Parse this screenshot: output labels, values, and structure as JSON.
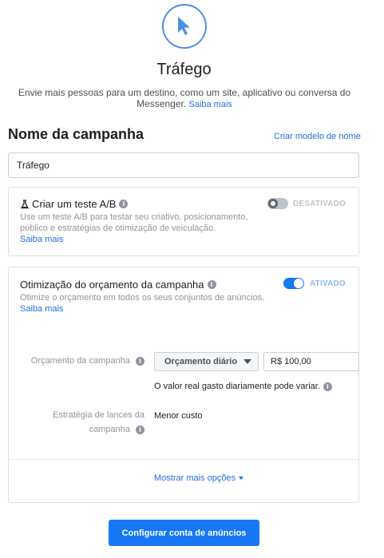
{
  "objective": {
    "icon": "cursor-icon",
    "title": "Tráfego",
    "description": "Envie mais pessoas para um destino, como um site, aplicativo ou conversa do Messenger.",
    "learn_more": "Saiba mais"
  },
  "campaign_name": {
    "title": "Nome da campanha",
    "template_link": "Criar modelo de nome",
    "value": "Tráfego"
  },
  "ab_test": {
    "title": "Criar um teste A/B",
    "description_line1": "Use um teste A/B para testar seu criativo, posicionamento,",
    "description_line2": "público e estratégias de otimização de veiculação.",
    "learn_more": "Saiba mais",
    "toggle_state": "DESATIVADO",
    "toggle_on": false
  },
  "budget_optimization": {
    "title": "Otimização do orçamento da campanha",
    "description": "Otimize o orçamento em todos os seus conjuntos de anúncios.",
    "learn_more": "Saiba mais",
    "toggle_state": "ATIVADO",
    "toggle_on": true,
    "budget_label": "Orçamento da campanha",
    "budget_type": "Orçamento diário",
    "budget_value": "R$ 100,00",
    "budget_note": "O valor real gasto diariamente pode variar.",
    "bid_label_line1": "Estratégia de lances da",
    "bid_label_line2": "campanha",
    "bid_value": "Menor custo",
    "more_options": "Mostrar mais opções"
  },
  "footer": {
    "primary_button": "Configurar conta de anúncios"
  },
  "colors": {
    "accent": "#1877f2",
    "link": "#216fdb",
    "muted": "#90949c"
  }
}
